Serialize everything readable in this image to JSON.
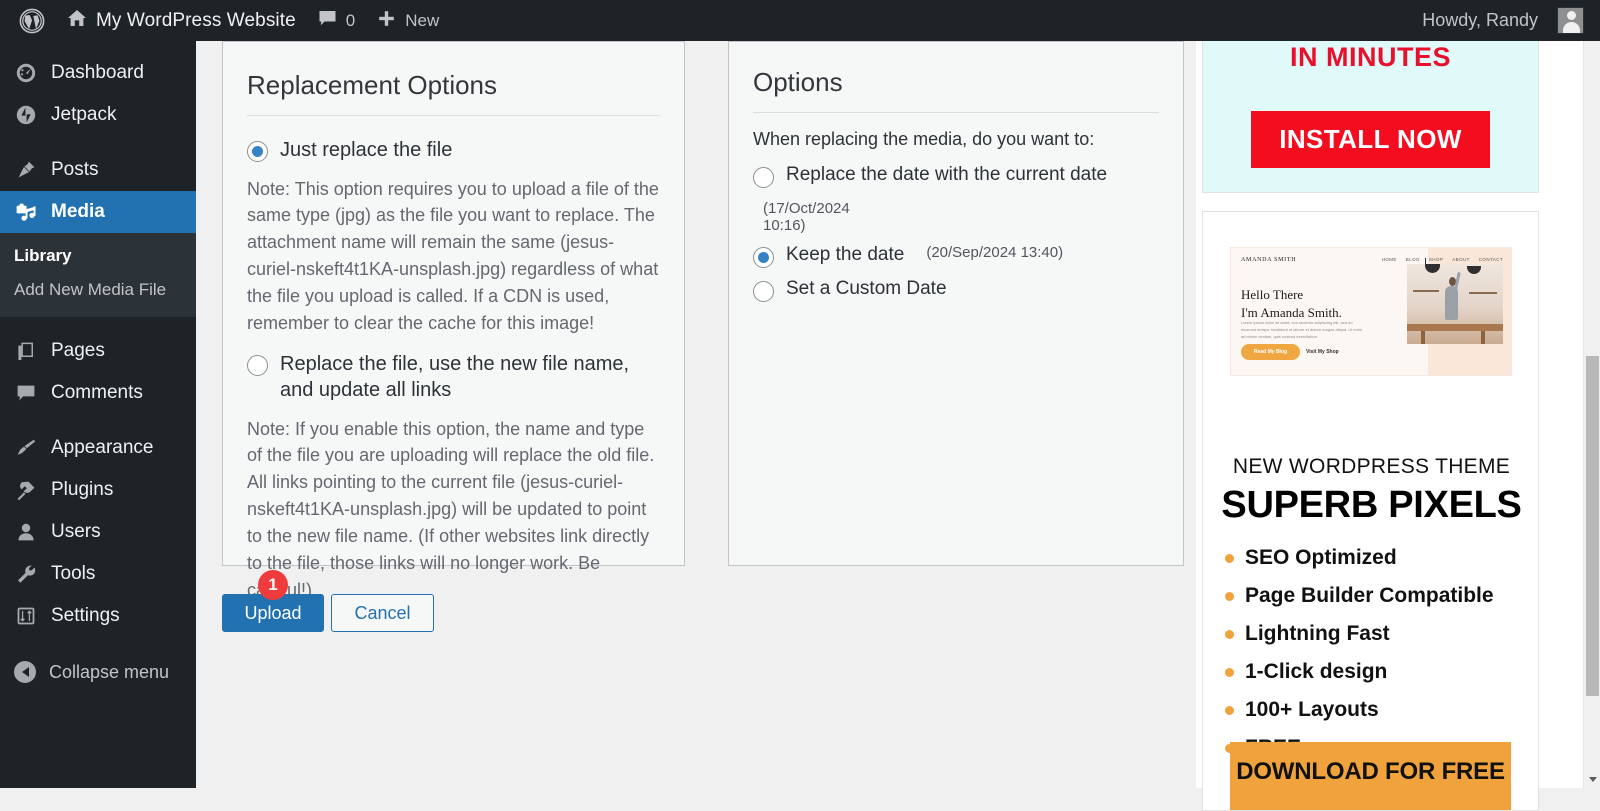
{
  "adminbar": {
    "logo_icon": "wordpress-logo-icon",
    "home_icon": "home-icon",
    "site_name": "My WordPress Website",
    "comments_icon": "comment-bubble-icon",
    "comments_count": "0",
    "new_icon": "plus-icon",
    "new_label": "New",
    "howdy": "Howdy, Randy",
    "avatar_icon": "avatar-icon"
  },
  "sidebar": {
    "items": [
      {
        "label": "Dashboard",
        "icon": "dashboard-icon",
        "current": false
      },
      {
        "label": "Jetpack",
        "icon": "jetpack-icon",
        "current": false
      },
      {
        "label": "Posts",
        "icon": "pin-icon",
        "current": false
      },
      {
        "label": "Media",
        "icon": "media-icon",
        "current": true
      },
      {
        "label": "Pages",
        "icon": "pages-icon",
        "current": false
      },
      {
        "label": "Comments",
        "icon": "comments-icon",
        "current": false
      },
      {
        "label": "Appearance",
        "icon": "paintbrush-icon",
        "current": false
      },
      {
        "label": "Plugins",
        "icon": "plug-icon",
        "current": false
      },
      {
        "label": "Users",
        "icon": "user-icon",
        "current": false
      },
      {
        "label": "Tools",
        "icon": "wrench-icon",
        "current": false
      },
      {
        "label": "Settings",
        "icon": "sliders-icon",
        "current": false
      }
    ],
    "submenu": [
      {
        "label": "Library",
        "current": true
      },
      {
        "label": "Add New Media File",
        "current": false
      }
    ],
    "collapse_label": "Collapse menu",
    "collapse_icon": "collapse-arrow-icon"
  },
  "replacement_panel": {
    "title": "Replacement Options",
    "option1": {
      "label": "Just replace the file",
      "checked": true,
      "note": "Note: This option requires you to upload a file of the same type (jpg) as the file you want to replace. The attachment name will remain the same (jesus-curiel-nskeft4t1KA-unsplash.jpg) regardless of what the file you upload is called. If a CDN is used, remember to clear the cache for this image!"
    },
    "option2": {
      "label": "Replace the file, use the new file name, and update all links",
      "checked": false,
      "note": "Note: If you enable this option, the name and type of the file you are uploading will replace the old file. All links pointing to the current file (jesus-curiel-nskeft4t1KA-unsplash.jpg) will be updated to point to the new file name. (If other websites link directly to the file, those links will no longer work. Be careful!)"
    }
  },
  "options_panel": {
    "title": "Options",
    "intro": "When replacing the media, do you want to:",
    "choices": [
      {
        "label": "Replace the date with the current date",
        "date": "(17/Oct/2024 10:16)",
        "checked": false
      },
      {
        "label": "Keep the date",
        "date": "(20/Sep/2024 13:40)",
        "checked": true
      },
      {
        "label": "Set a Custom Date",
        "date": "",
        "checked": false
      }
    ]
  },
  "actions": {
    "upload_label": "Upload",
    "cancel_label": "Cancel",
    "badge_number": "1"
  },
  "ad_top": {
    "headline": "IN MINUTES",
    "cta_label": "INSTALL NOW",
    "background_color": "#e0fafa",
    "headline_color": "#e8112d",
    "cta_color": "#f30d1e"
  },
  "ad_theme": {
    "preview": {
      "brand": "AMANDA SMITH",
      "nav": [
        "HOME",
        "BLOG",
        "SHOP",
        "ABOUT",
        "CONTACT"
      ],
      "heading_line1": "Hello There",
      "heading_line2": "I'm Amanda Smith.",
      "paragraph": "Lorem ipsum dolor sit amet, con sectetur adipiscing elit, sed do eiusmod tempor incididunt ut labore et dolore magna aliqua. Ut enim ad minim veniam, quis nostrud exercitation.",
      "button_primary": "Read My Blog",
      "button_secondary": "Visit My Shop"
    },
    "eyebrow": "NEW WORDPRESS THEME",
    "title": "SUPERB PIXELS",
    "features": [
      "SEO Optimized",
      "Page Builder Compatible",
      "Lightning Fast",
      "1-Click design",
      "100+ Layouts",
      "FREE"
    ],
    "cta_label": "DOWNLOAD FOR FREE",
    "accent_color": "#f0a33c"
  },
  "scrollbar": {
    "up_icon": "scroll-up-arrow-icon",
    "down_icon": "scroll-down-arrow-icon"
  }
}
